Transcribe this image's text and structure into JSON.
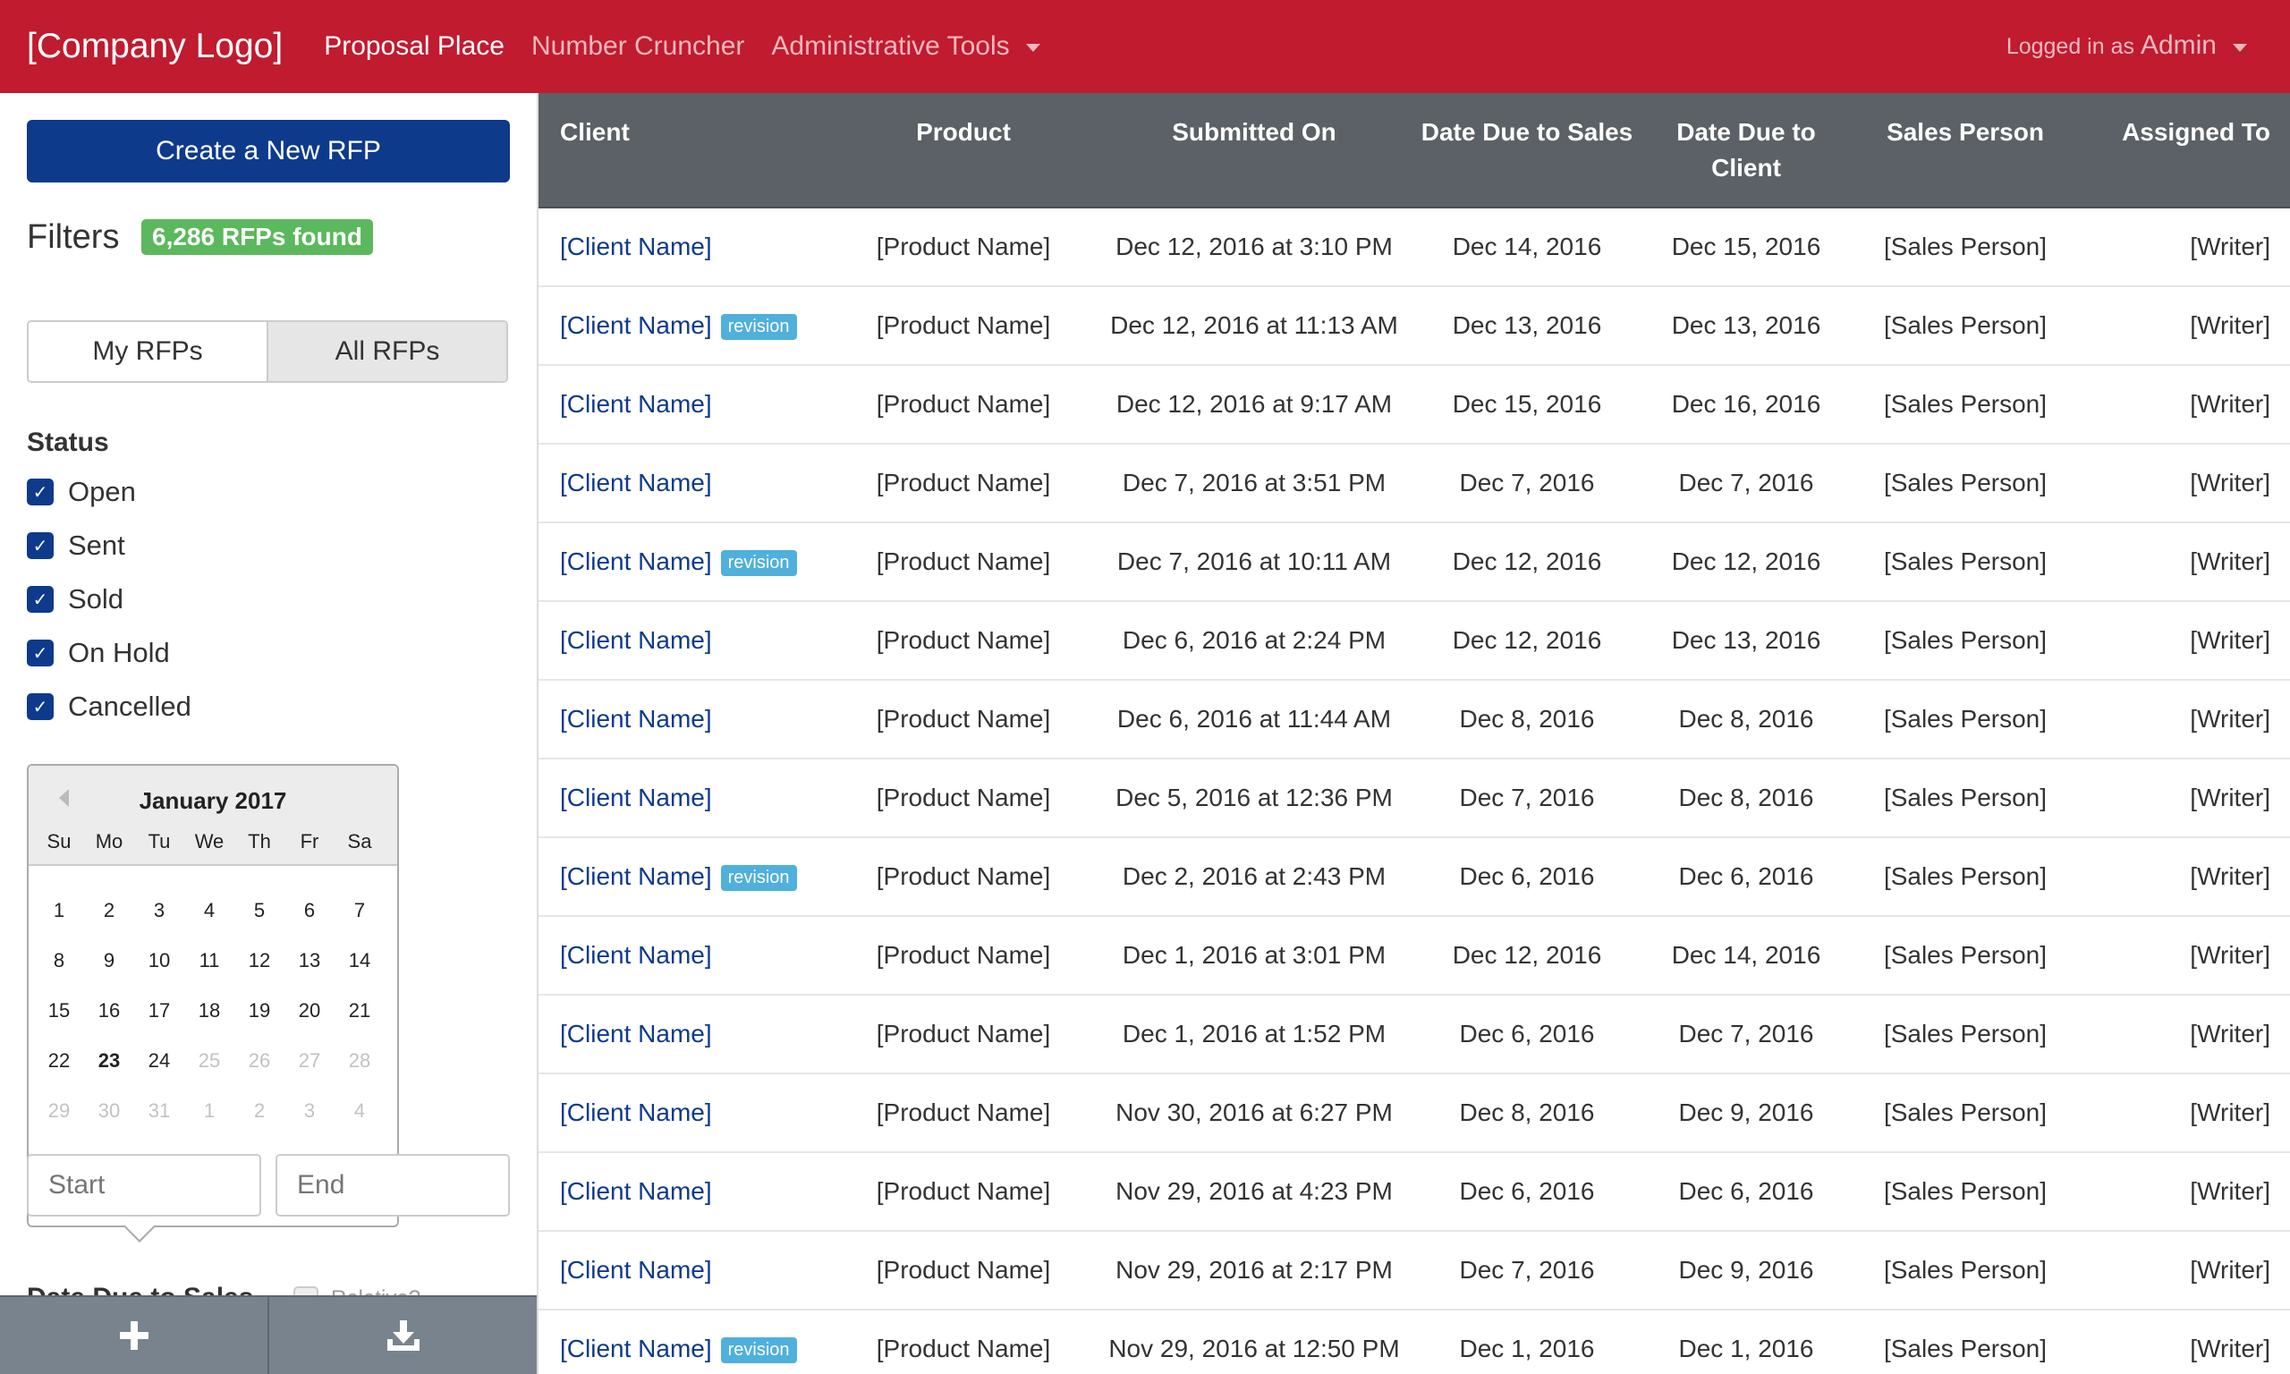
{
  "header": {
    "logo": "[Company Logo]",
    "nav": [
      "Proposal Place",
      "Number Cruncher",
      "Administrative Tools"
    ],
    "login_prefix": "Logged in as",
    "user": "Admin"
  },
  "sidebar": {
    "create_label": "Create a New RFP",
    "filters_title": "Filters",
    "found_badge": "6,286 RFPs found",
    "toggle": [
      "My RFPs",
      "All RFPs"
    ],
    "status_title": "Status",
    "statuses": [
      "Open",
      "Sent",
      "Sold",
      "On Hold",
      "Cancelled"
    ],
    "calendar": {
      "month": "January 2017",
      "dows": [
        "Su",
        "Mo",
        "Tu",
        "We",
        "Th",
        "Fr",
        "Sa"
      ],
      "days": [
        "1",
        "2",
        "3",
        "4",
        "5",
        "6",
        "7",
        "8",
        "9",
        "10",
        "11",
        "12",
        "13",
        "14",
        "15",
        "16",
        "17",
        "18",
        "19",
        "20",
        "21",
        "22",
        "23",
        "24",
        "25",
        "26",
        "27",
        "28",
        "29",
        "30",
        "31",
        "1",
        "2",
        "3",
        "4"
      ],
      "today": "23"
    },
    "start_placeholder": "Start",
    "end_placeholder": "End",
    "due_sales_title": "Date Due to Sales",
    "relative_label": "Relative?",
    "colors": {
      "accent": "#0e3a8c",
      "brand": "#c01b2f",
      "badge": "#5cb85c",
      "revision": "#4fb0dc"
    }
  },
  "table": {
    "columns": [
      "Client",
      "Product",
      "Submitted On",
      "Date Due to Sales",
      "Date Due to Client",
      "Sales Person",
      "Assigned To"
    ],
    "revision_label": "revision",
    "rows": [
      {
        "client": "[Client Name]",
        "revision": false,
        "product": "[Product Name]",
        "submitted": "Dec 12, 2016 at 3:10 PM",
        "due_sales": "Dec 14, 2016",
        "due_client": "Dec 15, 2016",
        "sales": "[Sales Person]",
        "assigned": "[Writer]"
      },
      {
        "client": "[Client Name]",
        "revision": true,
        "product": "[Product Name]",
        "submitted": "Dec 12, 2016 at 11:13 AM",
        "due_sales": "Dec 13, 2016",
        "due_client": "Dec 13, 2016",
        "sales": "[Sales Person]",
        "assigned": "[Writer]"
      },
      {
        "client": "[Client Name]",
        "revision": false,
        "product": "[Product Name]",
        "submitted": "Dec 12, 2016 at 9:17 AM",
        "due_sales": "Dec 15, 2016",
        "due_client": "Dec 16, 2016",
        "sales": "[Sales Person]",
        "assigned": "[Writer]"
      },
      {
        "client": "[Client Name]",
        "revision": false,
        "product": "[Product Name]",
        "submitted": "Dec 7, 2016 at 3:51 PM",
        "due_sales": "Dec 7, 2016",
        "due_client": "Dec 7, 2016",
        "sales": "[Sales Person]",
        "assigned": "[Writer]"
      },
      {
        "client": "[Client Name]",
        "revision": true,
        "product": "[Product Name]",
        "submitted": "Dec 7, 2016 at 10:11 AM",
        "due_sales": "Dec 12, 2016",
        "due_client": "Dec 12, 2016",
        "sales": "[Sales Person]",
        "assigned": "[Writer]"
      },
      {
        "client": "[Client Name]",
        "revision": false,
        "product": "[Product Name]",
        "submitted": "Dec 6, 2016 at 2:24 PM",
        "due_sales": "Dec 12, 2016",
        "due_client": "Dec 13, 2016",
        "sales": "[Sales Person]",
        "assigned": "[Writer]"
      },
      {
        "client": "[Client Name]",
        "revision": false,
        "product": "[Product Name]",
        "submitted": "Dec 6, 2016 at 11:44 AM",
        "due_sales": "Dec 8, 2016",
        "due_client": "Dec 8, 2016",
        "sales": "[Sales Person]",
        "assigned": "[Writer]"
      },
      {
        "client": "[Client Name]",
        "revision": false,
        "product": "[Product Name]",
        "submitted": "Dec 5, 2016 at 12:36 PM",
        "due_sales": "Dec 7, 2016",
        "due_client": "Dec 8, 2016",
        "sales": "[Sales Person]",
        "assigned": "[Writer]"
      },
      {
        "client": "[Client Name]",
        "revision": true,
        "product": "[Product Name]",
        "submitted": "Dec 2, 2016 at 2:43 PM",
        "due_sales": "Dec 6, 2016",
        "due_client": "Dec 6, 2016",
        "sales": "[Sales Person]",
        "assigned": "[Writer]"
      },
      {
        "client": "[Client Name]",
        "revision": false,
        "product": "[Product Name]",
        "submitted": "Dec 1, 2016 at 3:01 PM",
        "due_sales": "Dec 12, 2016",
        "due_client": "Dec 14, 2016",
        "sales": "[Sales Person]",
        "assigned": "[Writer]"
      },
      {
        "client": "[Client Name]",
        "revision": false,
        "product": "[Product Name]",
        "submitted": "Dec 1, 2016 at 1:52 PM",
        "due_sales": "Dec 6, 2016",
        "due_client": "Dec 7, 2016",
        "sales": "[Sales Person]",
        "assigned": "[Writer]"
      },
      {
        "client": "[Client Name]",
        "revision": false,
        "product": "[Product Name]",
        "submitted": "Nov 30, 2016 at 6:27 PM",
        "due_sales": "Dec 8, 2016",
        "due_client": "Dec 9, 2016",
        "sales": "[Sales Person]",
        "assigned": "[Writer]"
      },
      {
        "client": "[Client Name]",
        "revision": false,
        "product": "[Product Name]",
        "submitted": "Nov 29, 2016 at 4:23 PM",
        "due_sales": "Dec 6, 2016",
        "due_client": "Dec 6, 2016",
        "sales": "[Sales Person]",
        "assigned": "[Writer]"
      },
      {
        "client": "[Client Name]",
        "revision": false,
        "product": "[Product Name]",
        "submitted": "Nov 29, 2016 at 2:17 PM",
        "due_sales": "Dec 7, 2016",
        "due_client": "Dec 9, 2016",
        "sales": "[Sales Person]",
        "assigned": "[Writer]"
      },
      {
        "client": "[Client Name]",
        "revision": true,
        "product": "[Product Name]",
        "submitted": "Nov 29, 2016 at 12:50 PM",
        "due_sales": "Dec 1, 2016",
        "due_client": "Dec 1, 2016",
        "sales": "[Sales Person]",
        "assigned": "[Writer]"
      }
    ]
  },
  "bottom_bar": {
    "icons": [
      "plus-icon",
      "download-icon"
    ]
  }
}
